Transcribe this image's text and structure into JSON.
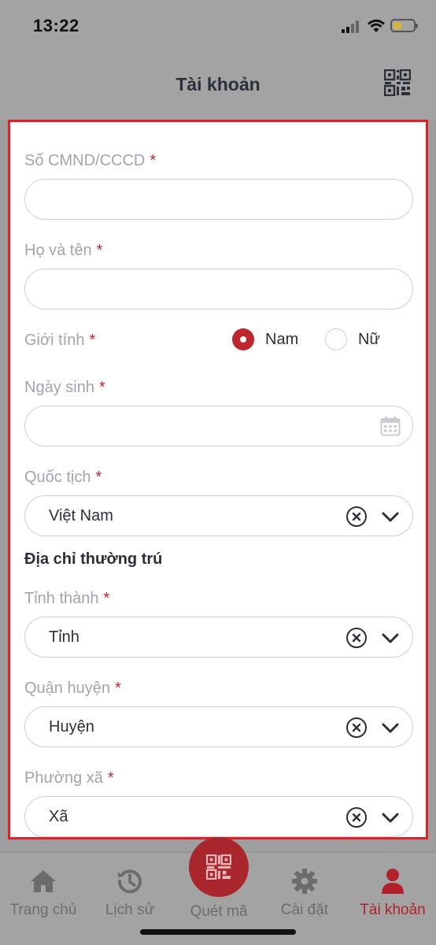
{
  "status": {
    "time": "13:22"
  },
  "header": {
    "title": "Tài khoản",
    "qr_icon": "qr-code-icon"
  },
  "form": {
    "id_number": {
      "label": "Số CMND/CCCD",
      "required": "*",
      "value": ""
    },
    "full_name": {
      "label": "Họ và tên",
      "required": "*",
      "value": ""
    },
    "gender": {
      "label": "Giới tính",
      "required": "*",
      "options": [
        "Nam",
        "Nữ"
      ],
      "selected": "Nam"
    },
    "birth_date": {
      "label": "Ngày sinh",
      "required": "*",
      "value": "",
      "icon": "calendar-icon"
    },
    "nationality": {
      "label": "Quốc tịch",
      "required": "*",
      "value": "Việt Nam"
    },
    "address_section": "Địa chỉ thường trú",
    "province": {
      "label": "Tỉnh thành",
      "required": "*",
      "value": "Tỉnh"
    },
    "district": {
      "label": "Quận huyện",
      "required": "*",
      "value": "Huyện"
    },
    "ward": {
      "label": "Phường xã",
      "required": "*",
      "value": "Xã"
    }
  },
  "tabs": [
    {
      "label": "Trang chủ",
      "icon": "home-icon"
    },
    {
      "label": "Lịch sử",
      "icon": "history-icon"
    },
    {
      "label": "Quét mã",
      "icon": "qr-scan-icon"
    },
    {
      "label": "Cài đặt",
      "icon": "gear-icon"
    },
    {
      "label": "Tài khoản",
      "icon": "user-icon",
      "active": true
    }
  ],
  "colors": {
    "accent": "#c0262d",
    "highlight_border": "#e11f26",
    "overlay": "#a3a3a3"
  }
}
